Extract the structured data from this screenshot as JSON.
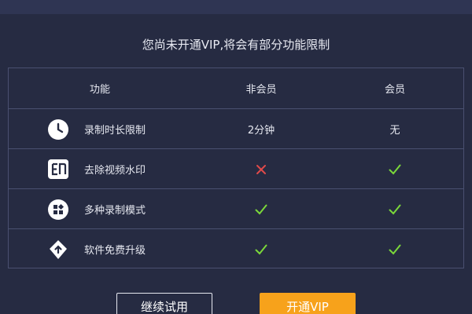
{
  "notice": "您尚未开通VIP,将会有部分功能限制",
  "table": {
    "headers": {
      "feature": "功能",
      "free": "非会员",
      "vip": "会员"
    },
    "rows": [
      {
        "feature": "录制时长限制",
        "icon": "clock-icon",
        "free": "2分钟",
        "vip": "无"
      },
      {
        "feature": "去除视频水印",
        "icon": "watermark-icon",
        "free": "cross",
        "vip": "check"
      },
      {
        "feature": "多种录制模式",
        "icon": "modes-icon",
        "free": "check",
        "vip": "check"
      },
      {
        "feature": "软件免费升级",
        "icon": "upgrade-icon",
        "free": "check",
        "vip": "check"
      }
    ]
  },
  "buttons": {
    "trial": "继续试用",
    "vip": "开通VIP"
  },
  "colors": {
    "background": "#262b42",
    "check": "#7bd83a",
    "cross": "#e04a4a",
    "accent": "#f7a21b"
  }
}
